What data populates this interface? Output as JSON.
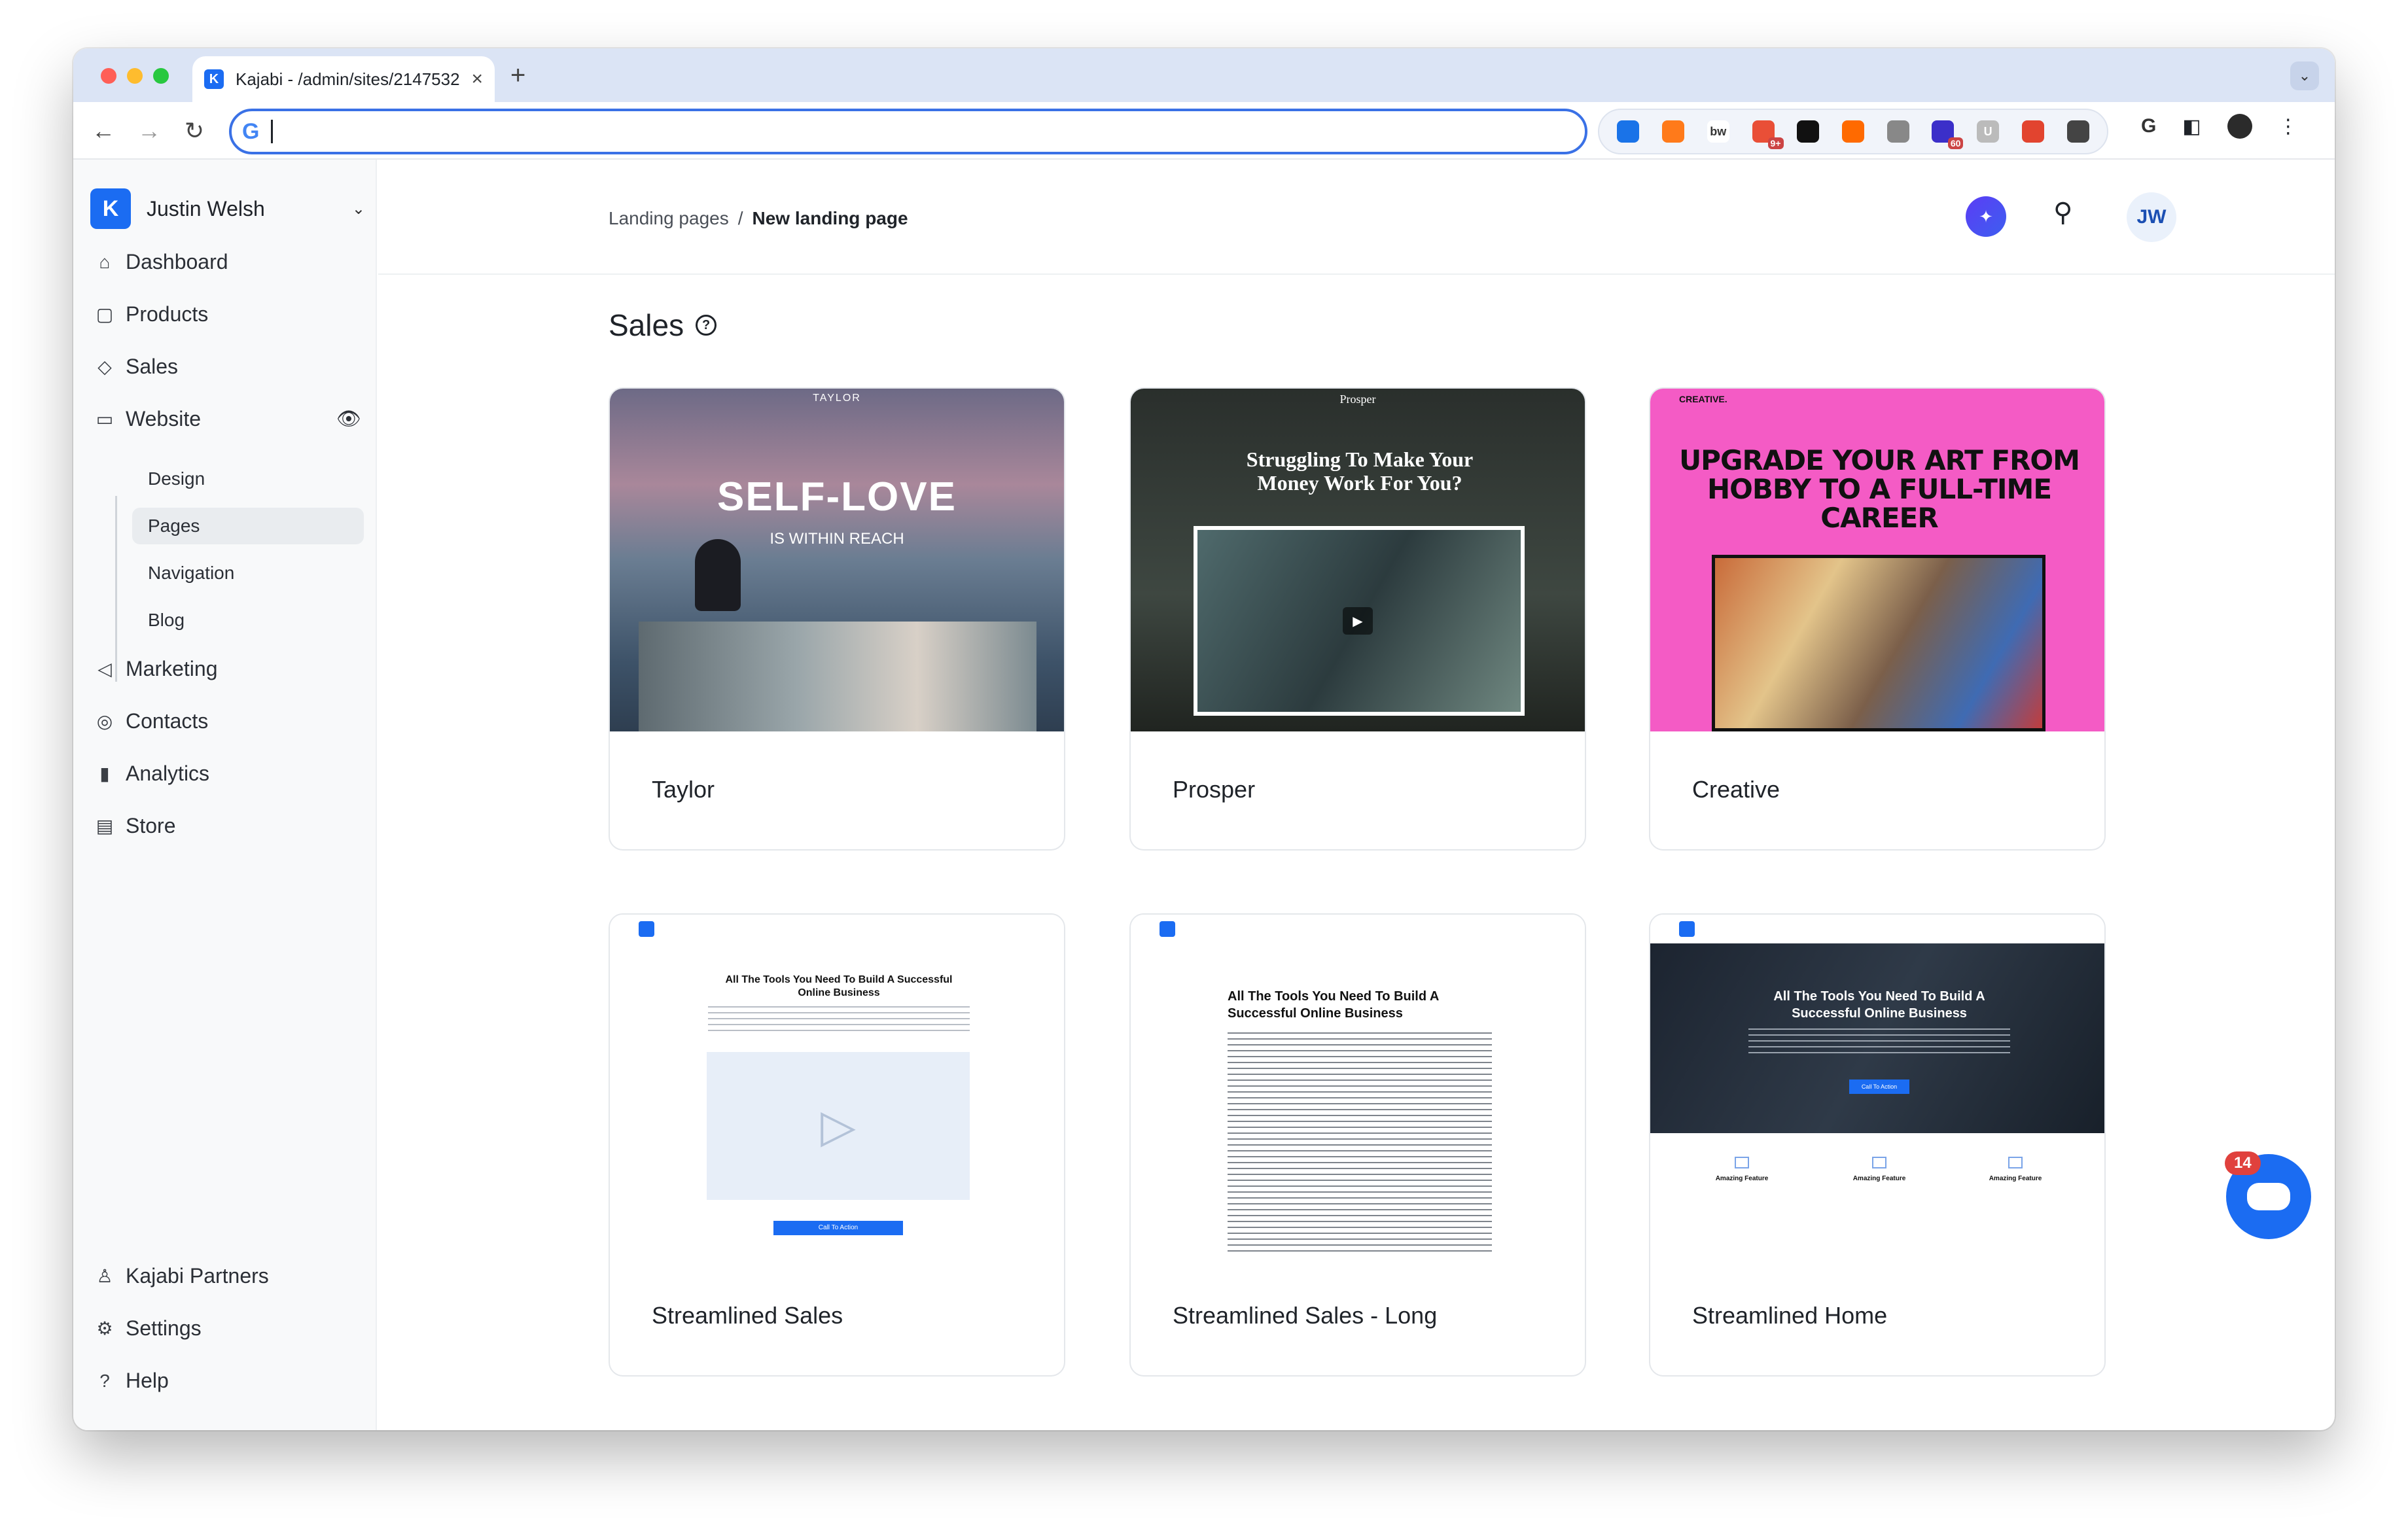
{
  "browser": {
    "tab_title": "Kajabi - /admin/sites/2147532",
    "tab_close": "×",
    "new_tab": "+",
    "address_value": "",
    "google_g": "G",
    "extensions": [
      {
        "name": "ext-blue-circle",
        "color": "#1a73e8",
        "label": ""
      },
      {
        "name": "ext-orange",
        "color": "#ff7a1a",
        "label": ""
      },
      {
        "name": "ext-bw",
        "color": "#ffffff",
        "label": "bw"
      },
      {
        "name": "ext-colorful",
        "color": "#e94f37",
        "label": "",
        "badge": "9+"
      },
      {
        "name": "ext-black-dot",
        "color": "#111111",
        "label": ""
      },
      {
        "name": "ext-arc",
        "color": "#ff6a00",
        "label": ""
      },
      {
        "name": "ext-gray",
        "color": "#888888",
        "label": ""
      },
      {
        "name": "ext-cap",
        "color": "#3b2fc9",
        "label": "",
        "badge": "60"
      },
      {
        "name": "ext-u",
        "color": "#bbbbbb",
        "label": "U"
      },
      {
        "name": "ext-red-stack",
        "color": "#e2442f",
        "label": ""
      },
      {
        "name": "ext-puzzle",
        "color": "#444444",
        "label": ""
      }
    ],
    "colors": {
      "tabbar": "#dbe4f5",
      "accent": "#1b6cf2"
    }
  },
  "sidebar": {
    "workspace": "Justin Welsh",
    "items": [
      {
        "label": "Dashboard",
        "icon": "home-icon",
        "glyph": "⌂"
      },
      {
        "label": "Products",
        "icon": "box-icon",
        "glyph": "▢"
      },
      {
        "label": "Sales",
        "icon": "tag-icon",
        "glyph": "◇"
      },
      {
        "label": "Website",
        "icon": "monitor-icon",
        "glyph": "▭"
      },
      {
        "label": "Marketing",
        "icon": "megaphone-icon",
        "glyph": "◁"
      },
      {
        "label": "Contacts",
        "icon": "contact-icon",
        "glyph": "◎"
      },
      {
        "label": "Analytics",
        "icon": "bar-chart-icon",
        "glyph": "▮"
      },
      {
        "label": "Store",
        "icon": "store-icon",
        "glyph": "▤"
      }
    ],
    "website_sub": [
      "Design",
      "Pages",
      "Navigation",
      "Blog"
    ],
    "active_sub": "Pages",
    "bottom": [
      {
        "label": "Kajabi Partners",
        "icon": "partners-icon",
        "glyph": "♙"
      },
      {
        "label": "Settings",
        "icon": "settings-icon",
        "glyph": "⚙"
      },
      {
        "label": "Help",
        "icon": "help-icon",
        "glyph": "?"
      }
    ]
  },
  "header": {
    "breadcrumb_parent": "Landing pages",
    "breadcrumb_sep": "/",
    "breadcrumb_current": "New landing page",
    "avatar": "JW"
  },
  "main": {
    "section_title": "Sales",
    "templates": [
      {
        "name": "Taylor",
        "thumb_title": "SELF-LOVE",
        "thumb_sub": "IS WITHIN REACH",
        "thumb_brand": "TAYLOR"
      },
      {
        "name": "Prosper",
        "thumb_title": "Struggling To Make Your Money Work For You?",
        "thumb_brand": "Prosper"
      },
      {
        "name": "Creative",
        "thumb_title": "UPGRADE YOUR ART FROM HOBBY TO A FULL-TIME CAREER",
        "thumb_brand": "CREATIVE."
      },
      {
        "name": "Streamlined Sales",
        "thumb_title": "All The Tools You Need To Build A Successful Online Business",
        "thumb_cta": "Call To Action"
      },
      {
        "name": "Streamlined Sales - Long",
        "thumb_title": "All The Tools You Need To Build A Successful Online Business"
      },
      {
        "name": "Streamlined Home",
        "thumb_title": "All The Tools You Need To Build A Successful Online Business",
        "thumb_cta": "Call To Action",
        "features": [
          "Amazing Feature",
          "Amazing Feature",
          "Amazing Feature"
        ]
      }
    ]
  },
  "chat": {
    "count": "14"
  }
}
